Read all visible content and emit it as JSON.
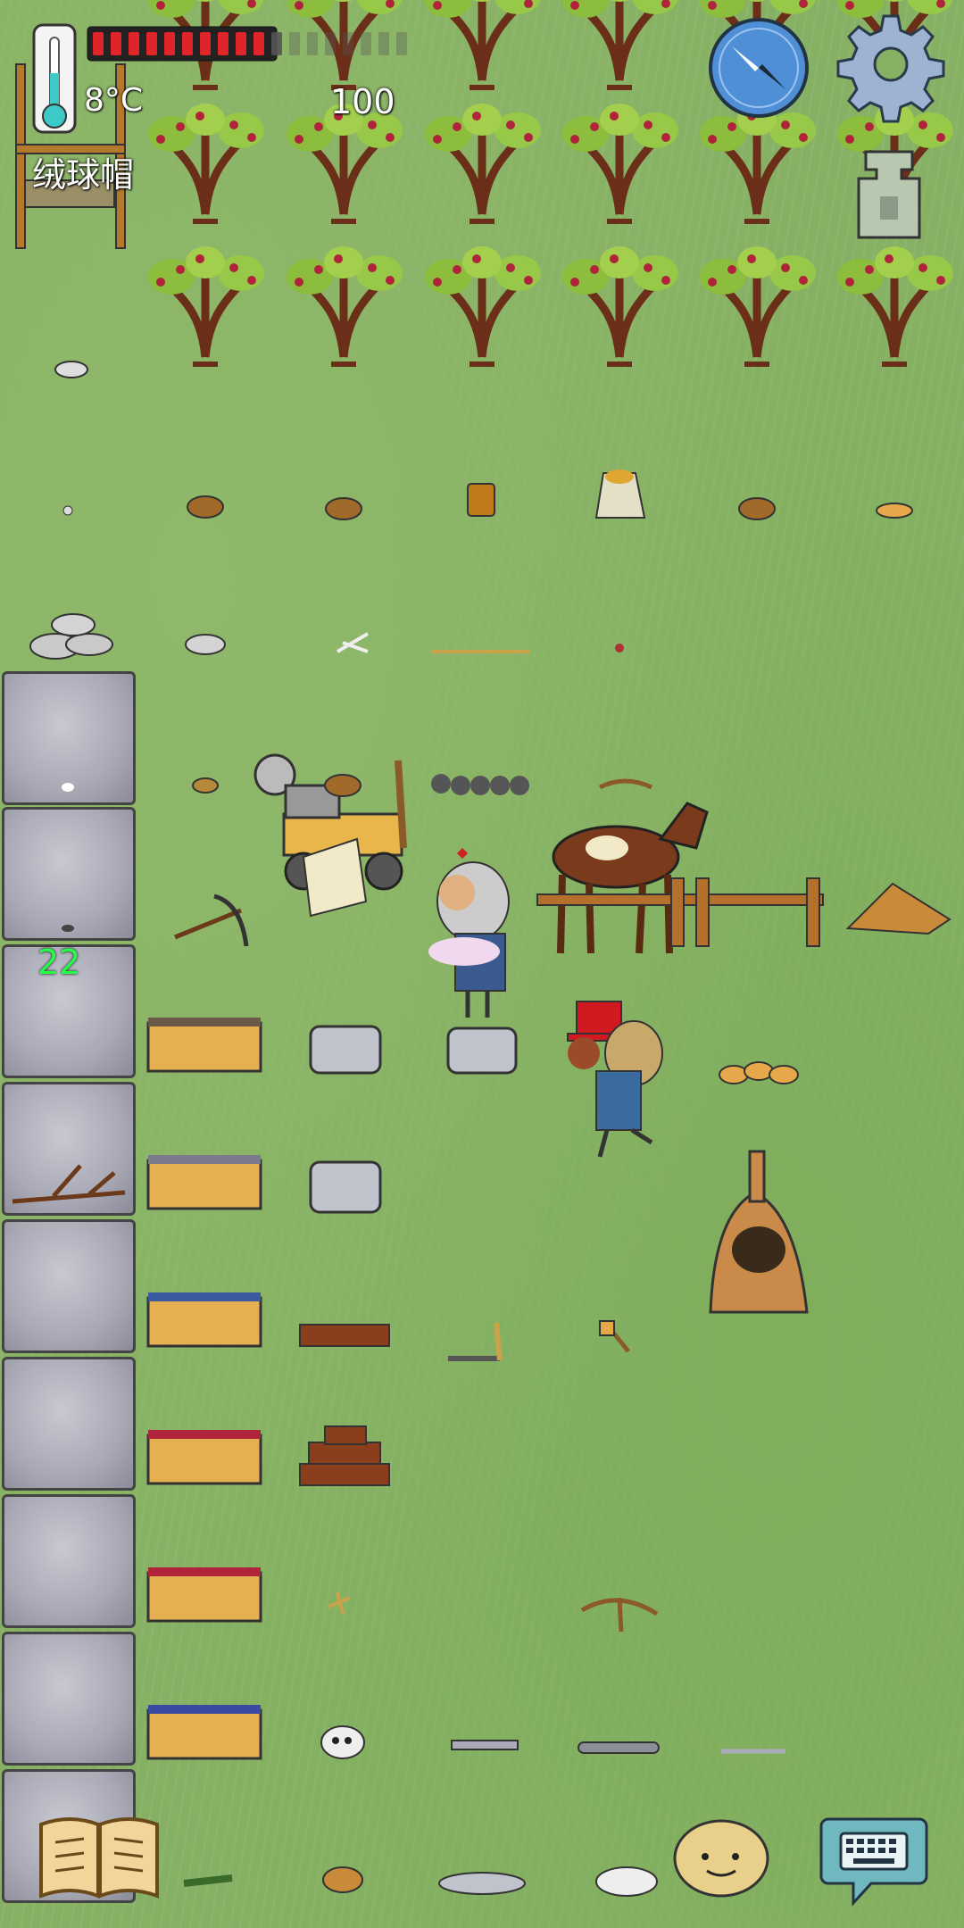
{
  "hud": {
    "temperature": "8°C",
    "worn_item": "绒球帽",
    "food_value": "100",
    "food_pips_filled": 10,
    "food_pips_total": 18,
    "age": "22"
  },
  "icons": {
    "thermometer": "thermometer-icon",
    "compass": "compass-icon",
    "settings": "gear-icon",
    "totem": "totem-icon",
    "tech_book": "book-icon",
    "emote": "emote-face-icon",
    "chat": "keyboard-chat-icon"
  },
  "colors": {
    "grass": "#86b063",
    "food_pip": "#e0242a",
    "food_pip_empty": "#555555",
    "age_text": "#22ff44",
    "compass_face": "#4f8fd6"
  }
}
